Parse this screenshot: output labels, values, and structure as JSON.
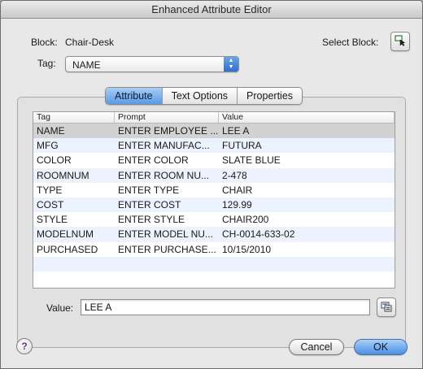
{
  "window": {
    "title": "Enhanced Attribute Editor"
  },
  "block": {
    "label": "Block:",
    "name": "Chair-Desk",
    "select_label": "Select Block:",
    "select_icon": "select-objects-icon"
  },
  "tag": {
    "label": "Tag:",
    "selected": "NAME"
  },
  "tabs": [
    {
      "label": "Attribute",
      "active": true
    },
    {
      "label": "Text Options",
      "active": false
    },
    {
      "label": "Properties",
      "active": false
    }
  ],
  "table": {
    "headers": {
      "tag": "Tag",
      "prompt": "Prompt",
      "value": "Value"
    },
    "rows": [
      {
        "tag": "NAME",
        "prompt": "ENTER EMPLOYEE ...",
        "value": "LEE A"
      },
      {
        "tag": "MFG",
        "prompt": "ENTER MANUFAC...",
        "value": "FUTURA"
      },
      {
        "tag": "COLOR",
        "prompt": "ENTER COLOR",
        "value": "SLATE BLUE"
      },
      {
        "tag": "ROOMNUM",
        "prompt": "ENTER ROOM NU...",
        "value": "2-478"
      },
      {
        "tag": "TYPE",
        "prompt": "ENTER TYPE",
        "value": "CHAIR"
      },
      {
        "tag": "COST",
        "prompt": "ENTER COST",
        "value": "129.99"
      },
      {
        "tag": "STYLE",
        "prompt": "ENTER STYLE",
        "value": "CHAIR200"
      },
      {
        "tag": "MODELNUM",
        "prompt": "ENTER MODEL NU...",
        "value": "CH-0014-633-02"
      },
      {
        "tag": "PURCHASED",
        "prompt": "ENTER PURCHASE...",
        "value": "10/15/2010"
      }
    ]
  },
  "value_field": {
    "label": "Value:",
    "value": "LEE A",
    "field_icon": "insert-field-icon"
  },
  "buttons": {
    "cancel": "Cancel",
    "ok": "OK",
    "help": "?"
  }
}
